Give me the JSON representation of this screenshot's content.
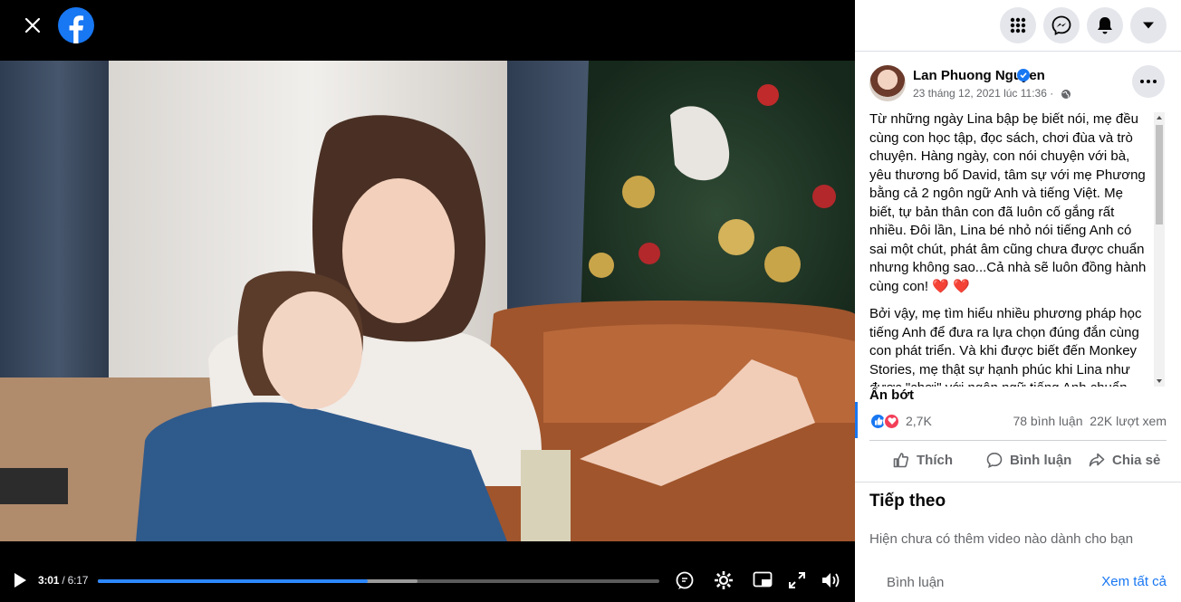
{
  "viewer": {
    "player": {
      "current_time": "3:01",
      "duration": "6:17",
      "progress": 0.48,
      "buffered": 0.57
    }
  },
  "header": {
    "menu_icon": "grid-menu-icon",
    "messenger_icon": "messenger-icon",
    "notifications_icon": "bell-icon",
    "account_icon": "caret-down-icon"
  },
  "post": {
    "author": "Lan Phuong Nguyen",
    "date": "23 tháng 12, 2021 lúc 11:36 ·",
    "paragraph1": "Từ những ngày Lina bập bẹ biết nói, mẹ đều cùng con học tập, đọc sách, chơi đùa và trò chuyện. Hàng ngày, con nói chuyện với bà, yêu thương bố David, tâm sự với mẹ Phương bằng cả 2 ngôn ngữ Anh và tiếng Việt. Mẹ biết, tự bản thân con đã luôn cố gắng rất nhiều. Đôi lần, Lina bé nhỏ nói tiếng Anh có sai một chút, phát âm cũng chưa được chuẩn nhưng không sao...Cả nhà sẽ luôn đồng hành cùng con!",
    "hearts1": "❤️ ❤️",
    "paragraph2": "Bởi vậy, mẹ tìm hiểu nhiều phương pháp học tiếng Anh để đưa ra lựa chọn đúng đắn cùng con phát triển. Và khi được biết đến Monkey Stories, mẹ thật sự hạnh phúc khi Lina như được \"chơi\" với ngôn ngữ tiếng Anh chuẩn",
    "hide_label": "Ẩn bớt",
    "reactions_count": "2,7K",
    "comments_count": "78 bình luận",
    "views_count": "22K lượt xem",
    "like_label": "Thích",
    "comment_label": "Bình luận",
    "share_label": "Chia sẻ"
  },
  "up_next": {
    "title": "Tiếp theo",
    "empty_text": "Hiện chưa có thêm video nào dành cho bạn"
  },
  "comments": {
    "label": "Bình luận",
    "see_all": "Xem tất cả"
  }
}
